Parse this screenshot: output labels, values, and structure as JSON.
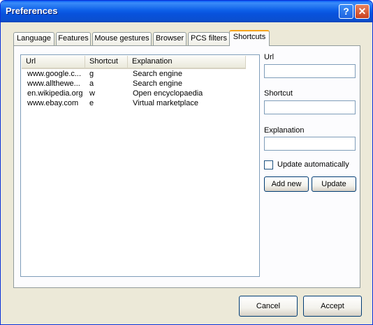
{
  "window": {
    "title": "Preferences"
  },
  "titlebar": {
    "help_glyph": "?",
    "close_glyph": "✕"
  },
  "tabs": [
    {
      "label": "Language"
    },
    {
      "label": "Features"
    },
    {
      "label": "Mouse gestures"
    },
    {
      "label": "Browser"
    },
    {
      "label": "PCS filters"
    },
    {
      "label": "Shortcuts",
      "active": true
    }
  ],
  "shortcuts_list": {
    "columns": [
      "Url",
      "Shortcut",
      "Explanation"
    ],
    "rows": [
      {
        "url": "www.google.c...",
        "shortcut": "g",
        "explanation": "Search engine"
      },
      {
        "url": "www.allthewe...",
        "shortcut": "a",
        "explanation": "Search engine"
      },
      {
        "url": "en.wikipedia.org",
        "shortcut": "w",
        "explanation": "Open encyclopaedia"
      },
      {
        "url": "www.ebay.com",
        "shortcut": "e",
        "explanation": "Virtual marketplace"
      }
    ]
  },
  "form": {
    "url_label": "Url",
    "url_value": "",
    "shortcut_label": "Shortcut",
    "shortcut_value": "",
    "explanation_label": "Explanation",
    "explanation_value": "",
    "update_auto_label": "Update automatically",
    "update_auto_checked": false,
    "add_new_label": "Add new",
    "update_label": "Update"
  },
  "footer": {
    "cancel_label": "Cancel",
    "accept_label": "Accept"
  },
  "colors": {
    "title_bar": "#0a5cf5",
    "dialog_bg": "#ece9d8",
    "active_tab_accent": "#f7a41b",
    "close_button": "#c8401f"
  }
}
